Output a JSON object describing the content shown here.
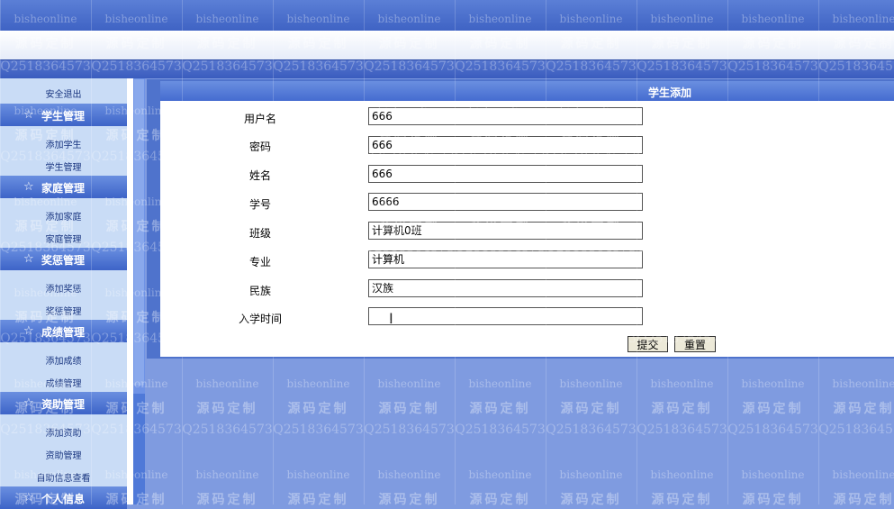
{
  "watermark": {
    "site": "bisheonline",
    "tagline": "源码定制",
    "qq": "Q2518364573"
  },
  "sidebar": {
    "logout": "安全退出",
    "sections": [
      {
        "title": "学生管理",
        "items": [
          "添加学生",
          "学生管理"
        ]
      },
      {
        "title": "家庭管理",
        "items": [
          "添加家庭",
          "家庭管理"
        ]
      },
      {
        "title": "奖惩管理",
        "items": [
          "添加奖惩",
          "奖惩管理"
        ]
      },
      {
        "title": "成绩管理",
        "items": [
          "添加成绩",
          "成绩管理"
        ]
      },
      {
        "title": "资助管理",
        "items": [
          "添加资助",
          "资助管理",
          "自助信息查看"
        ]
      },
      {
        "title": "个人信息",
        "items": []
      }
    ],
    "icon": "star-icon"
  },
  "form": {
    "title": "学生添加",
    "fields": [
      {
        "label": "用户名",
        "value": "666"
      },
      {
        "label": "密码",
        "value": "666"
      },
      {
        "label": "姓名",
        "value": "666"
      },
      {
        "label": "学号",
        "value": "6666"
      },
      {
        "label": "班级",
        "value": "计算机0班"
      },
      {
        "label": "专业",
        "value": "计算机"
      },
      {
        "label": "民族",
        "value": "汉族"
      },
      {
        "label": "入学时间",
        "value": ""
      }
    ],
    "submit_label": "提交",
    "reset_label": "重置"
  },
  "colors": {
    "header_blue": "#3f63c4",
    "page_blue": "#7f9be0",
    "sidebar_bg": "#c9dcf6"
  }
}
